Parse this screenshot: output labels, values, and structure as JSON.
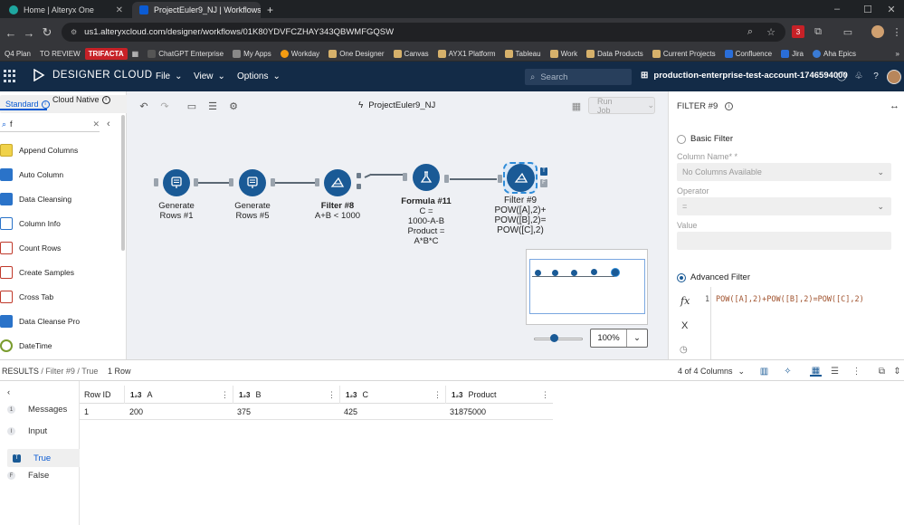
{
  "browser": {
    "tabs": [
      {
        "title": "Home | Alteryx One",
        "active": false
      },
      {
        "title": "ProjectEuler9_NJ | Workflows",
        "active": true
      }
    ],
    "new_tab": "+",
    "url": "us1.alteryxcloud.com/designer/workflows/01K80YDVFCZHAY343QBWMFGQSW",
    "extension_badge": "3",
    "bookmarks": [
      {
        "label": "Q4 Plan",
        "style": "plain"
      },
      {
        "label": "TO REVIEW",
        "style": "plain"
      },
      {
        "label": "TRIFACTA",
        "style": "red"
      },
      {
        "label": "ChatGPT Enterprise",
        "style": "icon"
      },
      {
        "label": "My Apps",
        "style": "icon"
      },
      {
        "label": "Workday",
        "style": "icon"
      },
      {
        "label": "One Designer",
        "style": "icon"
      },
      {
        "label": "Canvas",
        "style": "icon"
      },
      {
        "label": "AYX1 Platform",
        "style": "icon"
      },
      {
        "label": "Tableau",
        "style": "icon"
      },
      {
        "label": "Work",
        "style": "icon"
      },
      {
        "label": "Data Products",
        "style": "icon"
      },
      {
        "label": "Current Projects",
        "style": "icon"
      },
      {
        "label": "Confluence",
        "style": "icon"
      },
      {
        "label": "Jira",
        "style": "icon"
      },
      {
        "label": "Aha Epics",
        "style": "icon"
      }
    ]
  },
  "app": {
    "brand": "DESIGNER CLOUD",
    "menus": [
      "File",
      "View",
      "Options"
    ],
    "search_placeholder": "Search",
    "account": "production-enterprise-test-account-1746594000"
  },
  "tools": {
    "tabs": [
      "Standard",
      "Cloud Native"
    ],
    "search_value": "f",
    "items": [
      "Append Columns",
      "Auto Column",
      "Data Cleansing",
      "Column Info",
      "Count Rows",
      "Create Samples",
      "Cross Tab",
      "Data Cleanse Pro",
      "DateTime"
    ]
  },
  "canvas": {
    "workflow_name": "ProjectEuler9_NJ",
    "run_job": "Run Job",
    "zoom": "100%",
    "nodes": [
      {
        "title": "Generate",
        "lines": [
          "Rows #1"
        ]
      },
      {
        "title": "Generate",
        "lines": [
          "Rows #5"
        ]
      },
      {
        "title": "Filter #8",
        "lines": [
          "A+B < 1000"
        ]
      },
      {
        "title": "Formula #11",
        "lines": [
          "C =",
          "1000-A-B",
          "Product =",
          "A*B*C"
        ]
      },
      {
        "title": "Filter #9",
        "lines": [
          "POW([A],2)+",
          "POW([B],2)=",
          "POW([C],2)"
        ]
      }
    ],
    "anchor_labels": {
      "true": "T",
      "false": "F"
    }
  },
  "filter_panel": {
    "title": "FILTER #9",
    "basic_filter": "Basic Filter",
    "column_name_label": "Column Name* *",
    "column_name_value": "No Columns Available",
    "operator_label": "Operator",
    "operator_value": "=",
    "value_label": "Value",
    "advanced_filter": "Advanced Filter",
    "selected_mode": "advanced",
    "expression_line_no": "1",
    "expression": "POW([A],2)+POW([B],2)=POW([C],2)"
  },
  "results": {
    "breadcrumb_root": "RESULTS",
    "breadcrumb_tool": "Filter #9",
    "breadcrumb_output": "True",
    "row_count": "1 Row",
    "columns_selector": "4 of 4 Columns",
    "outputs": [
      {
        "label": "Messages",
        "badge": "1"
      },
      {
        "label": "Input",
        "badge": "I"
      },
      {
        "label": "True",
        "badge": "T"
      },
      {
        "label": "False",
        "badge": "F"
      }
    ],
    "selected_output": "True",
    "headers": [
      "Row ID",
      "A",
      "B",
      "C",
      "Product"
    ],
    "type_marker": "1₂3",
    "rows": [
      [
        "1",
        "200",
        "375",
        "425",
        "31875000"
      ]
    ]
  }
}
